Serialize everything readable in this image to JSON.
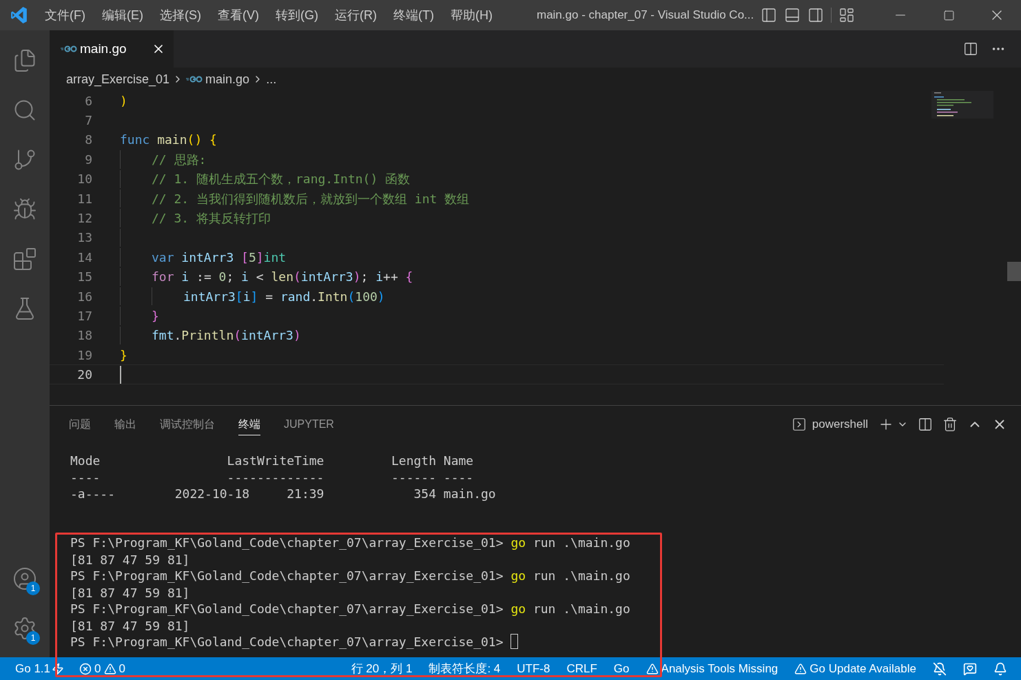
{
  "menu": [
    "文件(F)",
    "编辑(E)",
    "选择(S)",
    "查看(V)",
    "转到(G)",
    "运行(R)",
    "终端(T)",
    "帮助(H)"
  ],
  "window": {
    "title": "main.go - chapter_07 - Visual Studio Co..."
  },
  "activity_bar": {
    "accounts_badge": "1",
    "settings_badge": "1"
  },
  "editor_tabs": [
    {
      "label": "main.go",
      "selected": true
    }
  ],
  "breadcrumbs": [
    "array_Exercise_01",
    "main.go",
    "..."
  ],
  "code_lines": [
    {
      "number": "6",
      "current": false,
      "tokens": [
        {
          "kind": "b1",
          "text": ")"
        }
      ]
    },
    {
      "number": "7",
      "current": false
    },
    {
      "number": "8",
      "current": false,
      "tokens": [
        {
          "kind": "kw",
          "text": "func "
        },
        {
          "kind": "fn",
          "text": "main"
        },
        {
          "kind": "b1",
          "text": "()"
        },
        {
          "kind": "b1",
          "text": " {"
        }
      ],
      "children": [
        {
          "number": "9",
          "current": false,
          "tokens": [
            {
              "kind": "comment",
              "text": "// 思路:"
            }
          ]
        },
        {
          "number": "10",
          "current": false,
          "tokens": [
            {
              "kind": "comment",
              "text": "// 1. 随机生成五个数，rang.Intn() 函数"
            }
          ]
        },
        {
          "number": "11",
          "current": false,
          "tokens": [
            {
              "kind": "comment",
              "text": "// 2. 当我们得到随机数后，就放到一个数组 int 数组"
            }
          ]
        },
        {
          "number": "12",
          "current": false,
          "tokens": [
            {
              "kind": "comment",
              "text": "// 3. 将其反转打印"
            }
          ]
        },
        {
          "number": "13",
          "current": false
        },
        {
          "number": "14",
          "current": false,
          "tokens": [
            {
              "kind": "kw",
              "text": "var "
            },
            {
              "kind": "var",
              "text": "intArr3 "
            },
            {
              "kind": "b2",
              "text": "["
            },
            {
              "kind": "num",
              "text": "5"
            },
            {
              "kind": "b2",
              "text": "]"
            },
            {
              "kind": "type",
              "text": "int"
            }
          ]
        },
        {
          "number": "15",
          "current": false,
          "tokens": [
            {
              "kind": "ctrl",
              "text": "for "
            },
            {
              "kind": "var",
              "text": "i"
            },
            {
              "kind": "plain",
              "text": " := "
            },
            {
              "kind": "num",
              "text": "0"
            },
            {
              "kind": "plain",
              "text": "; "
            },
            {
              "kind": "var",
              "text": "i"
            },
            {
              "kind": "plain",
              "text": " < "
            },
            {
              "kind": "fn",
              "text": "len"
            },
            {
              "kind": "b2",
              "text": "("
            },
            {
              "kind": "var",
              "text": "intArr3"
            },
            {
              "kind": "b2",
              "text": ")"
            },
            {
              "kind": "plain",
              "text": "; "
            },
            {
              "kind": "var",
              "text": "i"
            },
            {
              "kind": "plain",
              "text": "++ "
            },
            {
              "kind": "b2",
              "text": "{"
            }
          ],
          "children": [
            {
              "number": "16",
              "current": false,
              "tokens": [
                {
                  "kind": "var",
                  "text": "intArr3"
                },
                {
                  "kind": "b3",
                  "text": "["
                },
                {
                  "kind": "var",
                  "text": "i"
                },
                {
                  "kind": "b3",
                  "text": "]"
                },
                {
                  "kind": "plain",
                  "text": " = "
                },
                {
                  "kind": "var",
                  "text": "rand"
                },
                {
                  "kind": "plain",
                  "text": "."
                },
                {
                  "kind": "fn",
                  "text": "Intn"
                },
                {
                  "kind": "b3",
                  "text": "("
                },
                {
                  "kind": "num",
                  "text": "100"
                },
                {
                  "kind": "b3",
                  "text": ")"
                }
              ]
            }
          ]
        },
        {
          "number": "17",
          "current": false,
          "tokens": [
            {
              "kind": "b2",
              "text": "}"
            }
          ]
        },
        {
          "number": "18",
          "current": false,
          "tokens": [
            {
              "kind": "var",
              "text": "fmt"
            },
            {
              "kind": "plain",
              "text": "."
            },
            {
              "kind": "fn",
              "text": "Println"
            },
            {
              "kind": "b2",
              "text": "("
            },
            {
              "kind": "var",
              "text": "intArr3"
            },
            {
              "kind": "b2",
              "text": ")"
            }
          ]
        }
      ]
    },
    {
      "number": "19",
      "current": false,
      "tokens": [
        {
          "kind": "b1",
          "text": "}"
        }
      ]
    },
    {
      "number": "20",
      "current": true
    }
  ],
  "panel_tabs": [
    {
      "label": "问题",
      "selected": false
    },
    {
      "label": "输出",
      "selected": false
    },
    {
      "label": "调试控制台",
      "selected": false
    },
    {
      "label": "终端",
      "selected": true
    },
    {
      "label": "JUPYTER",
      "selected": false
    }
  ],
  "terminal_name": "powershell",
  "terminal_listing": [
    "Mode                 LastWriteTime         Length Name",
    "----                 -------------         ------ ----",
    "-a----        2022-10-18     21:39            354 main.go"
  ],
  "terminal_session": [
    {
      "prompt": "PS F:\\Program_KF\\Goland_Code\\chapter_07\\array_Exercise_01> ",
      "command": "go",
      "args": " run .\\main.go",
      "cursor": false
    },
    {
      "output": "[81 87 47 59 81]"
    },
    {
      "prompt": "PS F:\\Program_KF\\Goland_Code\\chapter_07\\array_Exercise_01> ",
      "command": "go",
      "args": " run .\\main.go",
      "cursor": false
    },
    {
      "output": "[81 87 47 59 81]"
    },
    {
      "prompt": "PS F:\\Program_KF\\Goland_Code\\chapter_07\\array_Exercise_01> ",
      "command": "go",
      "args": " run .\\main.go",
      "cursor": false
    },
    {
      "output": "[81 87 47 59 81]"
    },
    {
      "prompt": "PS F:\\Program_KF\\Goland_Code\\chapter_07\\array_Exercise_01> ",
      "cursor": true
    }
  ],
  "status_bar": {
    "go_version": "Go 1.1",
    "errors": "0",
    "warnings": "0",
    "position": "行 20，列 1",
    "tab_size": "制表符长度: 4",
    "encoding": "UTF-8",
    "eol": "CRLF",
    "language": "Go",
    "analysis": "Analysis Tools Missing",
    "update": "Go Update Available"
  }
}
